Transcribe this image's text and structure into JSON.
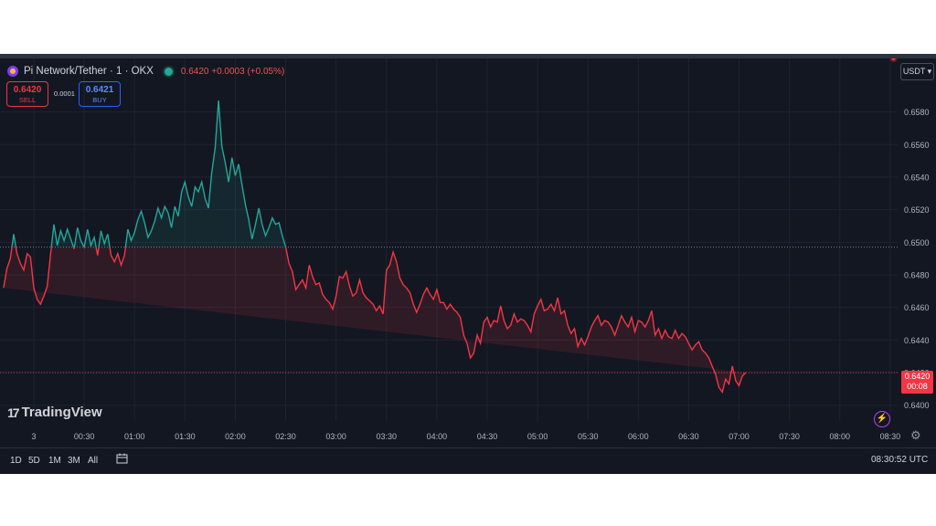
{
  "header": {
    "symbol": "Pi Network/Tether · 1 · OKX",
    "quote": "0.6420 +0.0003 (+0.05%)"
  },
  "trade": {
    "sell_price": "0.6420",
    "sell_label": "SELL",
    "spread": "0.0001",
    "buy_price": "0.6421",
    "buy_label": "BUY"
  },
  "currency_selector": "USDT ▾",
  "last_price_tag": {
    "price": "0.6420",
    "countdown": "00:08"
  },
  "logo": {
    "text": "TradingView",
    "mark": "17"
  },
  "toolbar": {
    "ranges": [
      "1D",
      "5D",
      "1M",
      "3M",
      "All"
    ],
    "clock": "08:30:52 UTC"
  },
  "colors": {
    "up": "#26a69a",
    "down": "#f23645",
    "background": "#131722",
    "grid": "#1f2330"
  },
  "chart_data": {
    "type": "line",
    "title": "Pi Network/Tether · 1 · OKX",
    "baseline": 0.6497,
    "last_price": 0.642,
    "ylim": [
      0.6392,
      0.6605
    ],
    "y_ticks": [
      0.64,
      0.642,
      0.644,
      0.646,
      0.648,
      0.65,
      0.652,
      0.654,
      0.656,
      0.658
    ],
    "x_tick_labels": [
      "3",
      "00:30",
      "01:00",
      "01:30",
      "02:00",
      "02:30",
      "03:00",
      "03:30",
      "04:00",
      "04:30",
      "05:00",
      "05:30",
      "06:00",
      "06:30",
      "07:00",
      "07:30",
      "08:00",
      "08:30"
    ],
    "x_tick_minutes": [
      0,
      30,
      60,
      90,
      120,
      150,
      180,
      210,
      240,
      270,
      300,
      330,
      360,
      390,
      420,
      450,
      480,
      510
    ],
    "grid": true,
    "series": [
      {
        "x_minutes": [
          -18,
          -16,
          -14,
          -12,
          -10,
          -8,
          -6,
          -4,
          -2,
          0,
          2,
          4,
          6,
          8,
          10,
          12,
          14,
          16,
          18,
          20,
          22,
          24,
          26,
          28,
          30,
          32,
          34,
          36,
          38,
          40,
          42,
          44,
          46,
          48,
          50,
          52,
          54,
          56,
          58,
          60,
          62,
          64,
          66,
          68,
          70,
          72,
          74,
          76,
          78,
          80,
          82,
          84,
          86,
          88,
          90,
          92,
          94,
          96,
          98,
          100,
          102,
          104,
          106,
          108,
          110,
          112,
          114,
          116,
          118,
          120,
          122,
          124,
          126,
          128,
          130,
          132,
          134,
          136,
          138,
          140,
          142,
          144,
          146,
          148,
          150,
          152,
          154,
          156,
          158,
          160,
          162,
          164,
          166,
          168,
          170,
          172,
          174,
          176,
          178,
          180,
          182,
          184,
          186,
          188,
          190,
          192,
          194,
          196,
          198,
          200,
          202,
          204,
          206,
          208,
          210,
          212,
          214,
          216,
          218,
          220,
          222,
          224,
          226,
          228,
          230,
          232,
          234,
          236,
          238,
          240,
          242,
          244,
          246,
          248,
          250,
          252,
          254,
          256,
          258,
          260,
          262,
          264,
          266,
          268,
          270,
          272,
          274,
          276,
          278,
          280,
          282,
          284,
          286,
          288,
          290,
          292,
          294,
          296,
          298,
          300,
          302,
          304,
          306,
          308,
          310,
          312,
          314,
          316,
          318,
          320,
          322,
          324,
          326,
          328,
          330,
          332,
          334,
          336,
          338,
          340,
          342,
          344,
          346,
          348,
          350,
          352,
          354,
          356,
          358,
          360,
          362,
          364,
          366,
          368,
          370,
          372,
          374,
          376,
          378,
          380,
          382,
          384,
          386,
          388,
          390,
          392,
          394,
          396,
          398,
          400,
          402,
          404,
          406,
          408,
          410,
          412,
          414,
          416,
          418,
          420,
          422,
          424,
          426,
          428,
          430,
          432,
          434,
          436,
          438,
          440,
          442,
          444,
          446,
          448,
          450,
          452,
          454,
          456,
          458,
          460,
          462,
          464,
          466,
          468,
          470,
          472,
          474,
          476,
          478,
          480,
          482,
          484,
          486,
          488,
          490,
          492,
          494,
          496,
          498,
          500,
          502,
          504,
          506,
          508,
          510,
          512
        ],
        "values": [
          0.6472,
          0.6484,
          0.649,
          0.6505,
          0.6493,
          0.6487,
          0.6483,
          0.6493,
          0.6491,
          0.6472,
          0.6465,
          0.6462,
          0.6467,
          0.6473,
          0.6493,
          0.6511,
          0.6498,
          0.6507,
          0.6501,
          0.6508,
          0.6502,
          0.6496,
          0.6509,
          0.6501,
          0.6497,
          0.6508,
          0.6498,
          0.6503,
          0.6492,
          0.6507,
          0.6499,
          0.6505,
          0.6492,
          0.6488,
          0.6493,
          0.6486,
          0.6492,
          0.6508,
          0.6501,
          0.6506,
          0.6514,
          0.6519,
          0.6512,
          0.6503,
          0.6507,
          0.6513,
          0.6521,
          0.6515,
          0.6522,
          0.6518,
          0.6509,
          0.6522,
          0.6516,
          0.6531,
          0.6537,
          0.6528,
          0.6522,
          0.6534,
          0.6531,
          0.6537,
          0.6527,
          0.6521,
          0.6543,
          0.6558,
          0.6587,
          0.6559,
          0.6549,
          0.6537,
          0.6552,
          0.6541,
          0.6548,
          0.6535,
          0.6523,
          0.6514,
          0.6502,
          0.6511,
          0.6521,
          0.6511,
          0.6504,
          0.6509,
          0.6515,
          0.6511,
          0.6512,
          0.6504,
          0.6497,
          0.6487,
          0.6482,
          0.6471,
          0.6474,
          0.6477,
          0.6472,
          0.6486,
          0.6479,
          0.6474,
          0.6475,
          0.6468,
          0.6465,
          0.6463,
          0.6459,
          0.6467,
          0.6479,
          0.6478,
          0.6482,
          0.6473,
          0.6467,
          0.6469,
          0.6477,
          0.6469,
          0.6466,
          0.6464,
          0.6462,
          0.6458,
          0.6461,
          0.6456,
          0.6483,
          0.6486,
          0.6494,
          0.6488,
          0.6478,
          0.6474,
          0.6472,
          0.6469,
          0.6462,
          0.6457,
          0.6462,
          0.6468,
          0.6472,
          0.6468,
          0.6465,
          0.6471,
          0.6463,
          0.6463,
          0.6459,
          0.6462,
          0.6459,
          0.6457,
          0.6454,
          0.6443,
          0.6438,
          0.6429,
          0.6432,
          0.6443,
          0.6438,
          0.6451,
          0.6454,
          0.6448,
          0.6452,
          0.6451,
          0.6461,
          0.6452,
          0.6447,
          0.6449,
          0.6456,
          0.6451,
          0.6453,
          0.6452,
          0.6449,
          0.6445,
          0.6456,
          0.6461,
          0.6465,
          0.6458,
          0.6459,
          0.6462,
          0.6458,
          0.6466,
          0.6456,
          0.6458,
          0.6449,
          0.6444,
          0.6447,
          0.6436,
          0.6441,
          0.6437,
          0.6442,
          0.6448,
          0.6452,
          0.6455,
          0.6449,
          0.6452,
          0.6451,
          0.6448,
          0.6443,
          0.6449,
          0.6455,
          0.6451,
          0.6448,
          0.6454,
          0.6445,
          0.6452,
          0.6451,
          0.6448,
          0.6452,
          0.6458,
          0.6443,
          0.6447,
          0.6441,
          0.6446,
          0.6442,
          0.6441,
          0.6446,
          0.6441,
          0.6444,
          0.6442,
          0.6438,
          0.6434,
          0.6437,
          0.6439,
          0.6434,
          0.6432,
          0.6429,
          0.6424,
          0.6419,
          0.6411,
          0.6408,
          0.6416,
          0.6413,
          0.6424,
          0.6415,
          0.6412,
          0.6418,
          0.642
        ]
      }
    ]
  }
}
